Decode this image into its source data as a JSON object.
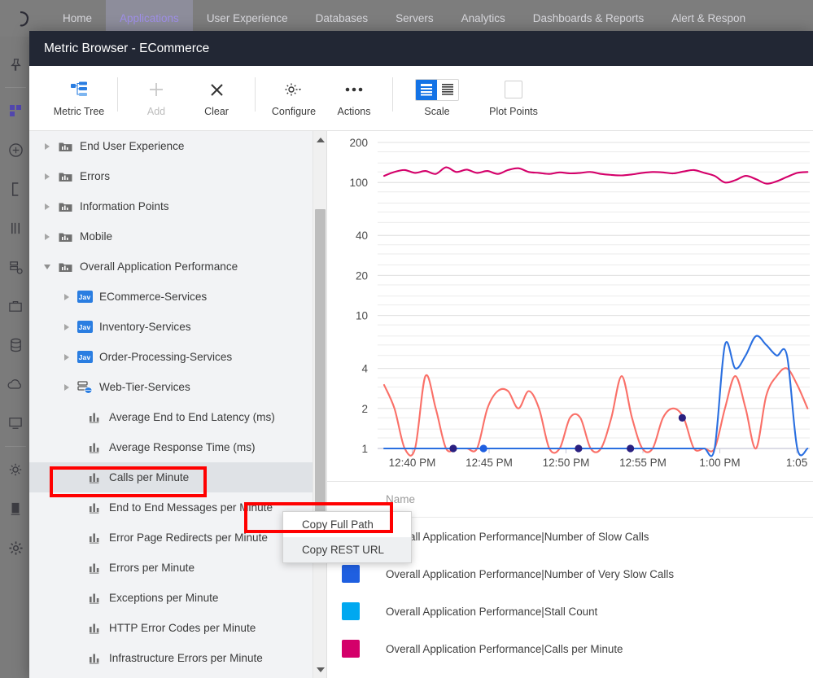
{
  "top_nav": {
    "logo_icon": "appdynamics-logo-icon",
    "items": [
      {
        "label": "Home",
        "active": false
      },
      {
        "label": "Applications",
        "active": true
      },
      {
        "label": "User Experience",
        "active": false
      },
      {
        "label": "Databases",
        "active": false
      },
      {
        "label": "Servers",
        "active": false
      },
      {
        "label": "Analytics",
        "active": false
      },
      {
        "label": "Dashboards & Reports",
        "active": false
      },
      {
        "label": "Alert & Respon",
        "active": false
      }
    ]
  },
  "left_rail": {
    "icons": [
      "pin-icon",
      "dashboard-grid-icon",
      "compass-icon",
      "bracket-icon",
      "bars-icon",
      "flow-map-icon",
      "briefcase-icon",
      "database-icon",
      "cloud-icon",
      "monitor-icon",
      "gear-icon",
      "book-icon",
      "settings-gear-icon"
    ]
  },
  "modal": {
    "title": "Metric Browser - ECommerce"
  },
  "toolbar": {
    "buttons": [
      {
        "label": "Metric Tree",
        "icon": "metric-tree-icon",
        "disabled": false
      },
      {
        "label": "Add",
        "icon": "plus-icon",
        "disabled": true
      },
      {
        "label": "Clear",
        "icon": "close-x-icon",
        "disabled": false
      },
      {
        "label": "Configure",
        "icon": "gear-dropdown-icon",
        "disabled": false
      },
      {
        "label": "Actions",
        "icon": "ellipsis-icon",
        "disabled": false
      }
    ],
    "scale": {
      "label": "Scale",
      "icon": "scale-toggle-icon",
      "selected": "logarithmic"
    },
    "plot_points": {
      "label": "Plot Points",
      "icon": "checkbox-icon",
      "checked": false
    }
  },
  "tree": {
    "rows": [
      {
        "label": "End User Experience",
        "indent": 1,
        "twisty": "right",
        "icon": "folder-chart-icon",
        "selected": false
      },
      {
        "label": "Errors",
        "indent": 1,
        "twisty": "right",
        "icon": "folder-chart-icon",
        "selected": false
      },
      {
        "label": "Information Points",
        "indent": 1,
        "twisty": "right",
        "icon": "folder-chart-icon",
        "selected": false
      },
      {
        "label": "Mobile",
        "indent": 1,
        "twisty": "right",
        "icon": "folder-chart-icon",
        "selected": false
      },
      {
        "label": "Overall Application Performance",
        "indent": 1,
        "twisty": "down",
        "icon": "folder-chart-icon",
        "selected": false
      },
      {
        "label": "ECommerce-Services",
        "indent": 2,
        "twisty": "right",
        "icon": "java-badge-icon",
        "selected": false
      },
      {
        "label": "Inventory-Services",
        "indent": 2,
        "twisty": "right",
        "icon": "java-badge-icon",
        "selected": false
      },
      {
        "label": "Order-Processing-Services",
        "indent": 2,
        "twisty": "right",
        "icon": "java-badge-icon",
        "selected": false
      },
      {
        "label": "Web-Tier-Services",
        "indent": 2,
        "twisty": "right",
        "icon": "web-tier-icon",
        "selected": false
      },
      {
        "label": "Average End to End Latency (ms)",
        "indent": 3,
        "twisty": "none",
        "icon": "metric-bars-icon",
        "selected": false
      },
      {
        "label": "Average Response Time (ms)",
        "indent": 3,
        "twisty": "none",
        "icon": "metric-bars-icon",
        "selected": false
      },
      {
        "label": "Calls per Minute",
        "indent": 3,
        "twisty": "none",
        "icon": "metric-bars-icon",
        "selected": true
      },
      {
        "label": "End to End Messages per Minute",
        "indent": 3,
        "twisty": "none",
        "icon": "metric-bars-icon",
        "selected": false
      },
      {
        "label": "Error Page Redirects per Minute",
        "indent": 3,
        "twisty": "none",
        "icon": "metric-bars-icon",
        "selected": false
      },
      {
        "label": "Errors per Minute",
        "indent": 3,
        "twisty": "none",
        "icon": "metric-bars-icon",
        "selected": false
      },
      {
        "label": "Exceptions per Minute",
        "indent": 3,
        "twisty": "none",
        "icon": "metric-bars-icon",
        "selected": false
      },
      {
        "label": "HTTP Error Codes per Minute",
        "indent": 3,
        "twisty": "none",
        "icon": "metric-bars-icon",
        "selected": false
      },
      {
        "label": "Infrastructure Errors per Minute",
        "indent": 3,
        "twisty": "none",
        "icon": "metric-bars-icon",
        "selected": false
      }
    ]
  },
  "context_menu": {
    "items": [
      {
        "label": "Copy Full Path",
        "hovered": false
      },
      {
        "label": "Copy REST URL",
        "hovered": true
      }
    ]
  },
  "legend": {
    "column_header": "Name",
    "rows": [
      {
        "color": "#3b2a9c",
        "name": "Overall Application Performance|Number of Slow Calls"
      },
      {
        "color": "#1f5fe0",
        "name": "Overall Application Performance|Number of Very Slow Calls"
      },
      {
        "color": "#00a8f0",
        "name": "Overall Application Performance|Stall Count"
      },
      {
        "color": "#d4006a",
        "name": "Overall Application Performance|Calls per Minute"
      }
    ]
  },
  "chart_data": {
    "type": "line",
    "title": "",
    "xlabel": "",
    "ylabel": "",
    "y_scale": "logarithmic",
    "grid": true,
    "legend_position": "bottom-table",
    "yticks": [
      1,
      2,
      4,
      10,
      20,
      40,
      100,
      200
    ],
    "ylim": [
      1,
      200
    ],
    "xticks": [
      "12:40 PM",
      "12:45 PM",
      "12:50 PM",
      "12:55 PM",
      "1:00 PM",
      "1:05"
    ],
    "x_range": [
      "12:38 PM",
      "1:06 PM"
    ],
    "series": [
      {
        "name": "Overall Application Performance|Calls per Minute",
        "color": "#d4006a",
        "values": [
          112,
          120,
          124,
          118,
          122,
          116,
          130,
          120,
          125,
          118,
          122,
          116,
          124,
          128,
          120,
          118,
          116,
          119,
          117,
          118,
          120,
          116,
          114,
          113,
          115,
          118,
          120,
          119,
          117,
          121,
          124,
          118,
          112,
          100,
          104,
          112,
          106,
          98,
          102,
          110,
          118,
          120
        ]
      },
      {
        "name": "Overall Application Performance|Number of Very Slow Calls",
        "color": "#2a6fe0",
        "values": [
          1,
          1,
          1,
          1,
          1,
          1,
          1,
          1,
          1,
          1,
          1,
          1,
          1,
          1,
          1,
          1,
          1,
          1,
          1,
          1,
          1,
          1,
          1,
          1,
          1,
          1,
          1,
          1,
          1,
          1,
          1,
          1,
          1,
          6,
          4,
          5,
          7,
          6,
          5,
          5,
          1,
          1
        ]
      },
      {
        "name": "Overall Application Performance|Number of Slow Calls",
        "color": "#fa7068",
        "values": [
          3,
          2,
          1,
          1,
          3.5,
          2,
          1,
          1,
          1,
          1,
          2,
          2.7,
          2.7,
          2,
          2.7,
          2,
          1,
          1,
          1.7,
          1.7,
          1,
          1,
          1.7,
          3.5,
          1.7,
          1,
          1,
          1.7,
          2,
          1.7,
          1,
          1,
          1,
          2,
          3.5,
          2,
          1,
          2.5,
          3.5,
          4,
          3,
          2
        ]
      },
      {
        "name": "Overall Application Performance|Stall Count",
        "color": "#8fa6e8",
        "values": [
          1,
          1,
          1,
          1,
          1,
          1,
          1,
          1,
          1,
          1,
          1,
          1,
          1,
          1,
          1,
          1,
          1,
          1,
          1,
          1,
          1,
          1,
          1,
          1,
          1,
          1,
          1,
          1,
          1,
          1,
          1,
          1,
          1,
          1,
          1,
          1,
          1,
          1,
          1,
          1,
          1,
          1
        ]
      }
    ],
    "markers": [
      {
        "x": 0.175,
        "y": 1,
        "color": "#2a2080",
        "label": "slow-calls-point"
      },
      {
        "x": 0.245,
        "y": 1,
        "color": "#1f5fe0",
        "label": "very-slow-calls-point"
      },
      {
        "x": 0.465,
        "y": 1,
        "color": "#2a2080",
        "label": "slow-calls-point"
      },
      {
        "x": 0.585,
        "y": 1,
        "color": "#2a2080",
        "label": "slow-calls-point"
      },
      {
        "x": 0.705,
        "y": 1.7,
        "color": "#2a2080",
        "label": "slow-calls-point"
      }
    ]
  }
}
